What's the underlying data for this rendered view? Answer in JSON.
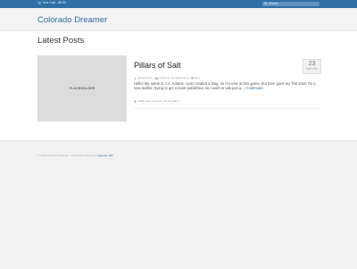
{
  "topbar": {
    "cart_label": "Your Cart - $0.00",
    "search_placeholder": "Search"
  },
  "header": {
    "site_title": "Colorado Dreamer"
  },
  "main": {
    "section_heading": "Latest Posts",
    "post": {
      "thumbnail_label": "PLACEHOLDER",
      "title": "Pillars of Salt",
      "date_day": "23",
      "date_month": "MAR 2015",
      "author": "jaadams123",
      "category": "Uncategorized",
      "comments": "56 6",
      "category_prefix": "posted in",
      "excerpt": "Hello! My name is J.A. Adams. I just created a blog, so I'm new at this game, but here goes my first shot! I'm a new author, trying to get a book published, so I want to talk just a…",
      "read_more": "Continued",
      "tags": "1995, book, cocaine, DS by Adams"
    }
  },
  "footer": {
    "copyright": "© 2015 Colorado Dreamer · WordPress Theme by",
    "theme_link": "Hueman WP"
  }
}
